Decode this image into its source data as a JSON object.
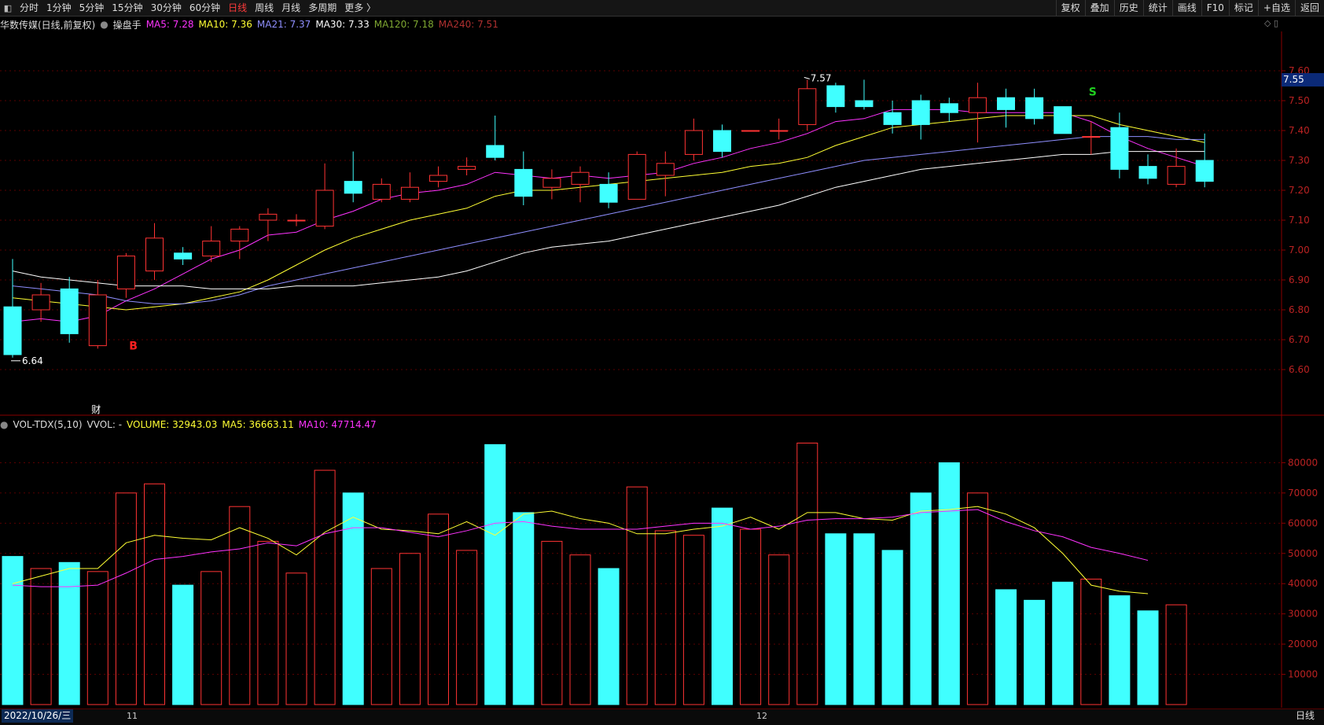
{
  "toolbar": {
    "tabs": [
      {
        "label": "分时",
        "active": false
      },
      {
        "label": "1分钟",
        "active": false
      },
      {
        "label": "5分钟",
        "active": false
      },
      {
        "label": "15分钟",
        "active": false
      },
      {
        "label": "30分钟",
        "active": false
      },
      {
        "label": "60分钟",
        "active": false
      },
      {
        "label": "日线",
        "active": true
      },
      {
        "label": "周线",
        "active": false
      },
      {
        "label": "月线",
        "active": false
      },
      {
        "label": "多周期",
        "active": false
      },
      {
        "label": "更多 〉",
        "active": false
      }
    ],
    "right_tools": [
      "复权",
      "叠加",
      "历史",
      "统计",
      "画线",
      "F10",
      "标记",
      "+自选",
      "返回"
    ]
  },
  "price_info": {
    "stock": "华数传媒(日线,前复权)",
    "indicator": "操盘手",
    "ma": [
      {
        "label": "MA5: 7.28",
        "color": "#ff33ff"
      },
      {
        "label": "MA10: 7.36",
        "color": "#ffff33"
      },
      {
        "label": "MA21: 7.37",
        "color": "#8f8fff"
      },
      {
        "label": "MA30: 7.33",
        "color": "#ffffff"
      },
      {
        "label": "MA120: 7.18",
        "color": "#7fa832"
      },
      {
        "label": "MA240: 7.51",
        "color": "#b03030"
      }
    ]
  },
  "vol_info": {
    "name": "VOL-TDX(5,10)",
    "vvol": "VVOL: -",
    "volume": "VOLUME: 32943.03",
    "ma5": "MA5: 36663.11",
    "ma10": "MA10: 47714.47"
  },
  "markers": {
    "high_label": "7.57",
    "low_label": "6.64",
    "buy": "B",
    "sell": "S",
    "finance": "财",
    "current_price": "7.55"
  },
  "colors": {
    "up": "#ff3333",
    "down": "#40ffff",
    "grid": "#5a0000",
    "axis": "#c0c0c0"
  },
  "x_axis": {
    "date": "2022/10/26/三",
    "month_11": "11",
    "month_12": "12",
    "period": "日线"
  },
  "chart_data": [
    {
      "type": "candlestick",
      "title": "华数传媒(日线,前复权)",
      "ylim": [
        6.6,
        7.6
      ],
      "y_ticks": [
        "7.60",
        "7.50",
        "7.40",
        "7.30",
        "7.20",
        "7.10",
        "7.00",
        "6.90",
        "6.80",
        "6.70",
        "6.60"
      ],
      "candles": [
        {
          "o": 6.81,
          "h": 6.97,
          "l": 6.64,
          "c": 6.65
        },
        {
          "o": 6.8,
          "h": 6.89,
          "l": 6.76,
          "c": 6.85
        },
        {
          "o": 6.87,
          "h": 6.91,
          "l": 6.69,
          "c": 6.72
        },
        {
          "o": 6.68,
          "h": 6.9,
          "l": 6.67,
          "c": 6.85
        },
        {
          "o": 6.87,
          "h": 6.99,
          "l": 6.84,
          "c": 6.98
        },
        {
          "o": 6.93,
          "h": 7.09,
          "l": 6.9,
          "c": 7.04
        },
        {
          "o": 6.99,
          "h": 7.01,
          "l": 6.95,
          "c": 6.97
        },
        {
          "o": 6.98,
          "h": 7.08,
          "l": 6.96,
          "c": 7.03
        },
        {
          "o": 7.03,
          "h": 7.08,
          "l": 6.97,
          "c": 7.07
        },
        {
          "o": 7.1,
          "h": 7.14,
          "l": 7.03,
          "c": 7.12
        },
        {
          "o": 7.1,
          "h": 7.12,
          "l": 7.08,
          "c": 7.1
        },
        {
          "o": 7.08,
          "h": 7.29,
          "l": 7.07,
          "c": 7.2
        },
        {
          "o": 7.23,
          "h": 7.33,
          "l": 7.16,
          "c": 7.19
        },
        {
          "o": 7.17,
          "h": 7.24,
          "l": 7.16,
          "c": 7.22
        },
        {
          "o": 7.17,
          "h": 7.26,
          "l": 7.16,
          "c": 7.21
        },
        {
          "o": 7.23,
          "h": 7.28,
          "l": 7.21,
          "c": 7.25
        },
        {
          "o": 7.27,
          "h": 7.31,
          "l": 7.25,
          "c": 7.28
        },
        {
          "o": 7.35,
          "h": 7.45,
          "l": 7.3,
          "c": 7.31
        },
        {
          "o": 7.27,
          "h": 7.33,
          "l": 7.15,
          "c": 7.18
        },
        {
          "o": 7.21,
          "h": 7.27,
          "l": 7.17,
          "c": 7.24
        },
        {
          "o": 7.22,
          "h": 7.28,
          "l": 7.16,
          "c": 7.26
        },
        {
          "o": 7.22,
          "h": 7.26,
          "l": 7.14,
          "c": 7.16
        },
        {
          "o": 7.17,
          "h": 7.33,
          "l": 7.17,
          "c": 7.32
        },
        {
          "o": 7.25,
          "h": 7.33,
          "l": 7.18,
          "c": 7.29
        },
        {
          "o": 7.32,
          "h": 7.44,
          "l": 7.3,
          "c": 7.4
        },
        {
          "o": 7.4,
          "h": 7.42,
          "l": 7.31,
          "c": 7.33
        },
        {
          "o": 7.4,
          "h": 7.4,
          "l": 7.4,
          "c": 7.4
        },
        {
          "o": 7.4,
          "h": 7.44,
          "l": 7.37,
          "c": 7.4
        },
        {
          "o": 7.42,
          "h": 7.57,
          "l": 7.4,
          "c": 7.54
        },
        {
          "o": 7.55,
          "h": 7.56,
          "l": 7.46,
          "c": 7.48
        },
        {
          "o": 7.5,
          "h": 7.57,
          "l": 7.47,
          "c": 7.48
        },
        {
          "o": 7.46,
          "h": 7.5,
          "l": 7.39,
          "c": 7.42
        },
        {
          "o": 7.5,
          "h": 7.52,
          "l": 7.37,
          "c": 7.42
        },
        {
          "o": 7.49,
          "h": 7.51,
          "l": 7.43,
          "c": 7.46
        },
        {
          "o": 7.46,
          "h": 7.56,
          "l": 7.36,
          "c": 7.51
        },
        {
          "o": 7.51,
          "h": 7.54,
          "l": 7.41,
          "c": 7.47
        },
        {
          "o": 7.51,
          "h": 7.54,
          "l": 7.42,
          "c": 7.44
        },
        {
          "o": 7.48,
          "h": 7.48,
          "l": 7.39,
          "c": 7.39
        },
        {
          "o": 7.38,
          "h": 7.43,
          "l": 7.32,
          "c": 7.38
        },
        {
          "o": 7.41,
          "h": 7.46,
          "l": 7.24,
          "c": 7.27
        },
        {
          "o": 7.28,
          "h": 7.32,
          "l": 7.22,
          "c": 7.24
        },
        {
          "o": 7.22,
          "h": 7.34,
          "l": 7.21,
          "c": 7.28
        },
        {
          "o": 7.3,
          "h": 7.39,
          "l": 7.21,
          "c": 7.23
        }
      ],
      "series": [
        {
          "name": "MA5",
          "color": "#ff33ff",
          "values": [
            6.76,
            6.77,
            6.76,
            6.78,
            6.83,
            6.87,
            6.92,
            6.97,
            7.0,
            7.05,
            7.06,
            7.1,
            7.13,
            7.17,
            7.19,
            7.2,
            7.22,
            7.26,
            7.25,
            7.24,
            7.25,
            7.24,
            7.25,
            7.26,
            7.29,
            7.31,
            7.34,
            7.36,
            7.39,
            7.43,
            7.44,
            7.47,
            7.47,
            7.47,
            7.46,
            7.46,
            7.46,
            7.46,
            7.43,
            7.38,
            7.34,
            7.31,
            7.28
          ]
        },
        {
          "name": "MA10",
          "color": "#ffff33",
          "values": [
            6.84,
            6.83,
            6.82,
            6.81,
            6.8,
            6.81,
            6.82,
            6.84,
            6.86,
            6.9,
            6.95,
            7.0,
            7.04,
            7.07,
            7.1,
            7.12,
            7.14,
            7.18,
            7.2,
            7.2,
            7.21,
            7.22,
            7.23,
            7.24,
            7.25,
            7.26,
            7.28,
            7.29,
            7.31,
            7.35,
            7.38,
            7.41,
            7.42,
            7.43,
            7.44,
            7.45,
            7.45,
            7.45,
            7.45,
            7.42,
            7.4,
            7.38,
            7.36
          ]
        },
        {
          "name": "MA21",
          "color": "#8f8fff",
          "values": [
            6.88,
            6.87,
            6.86,
            6.85,
            6.83,
            6.82,
            6.82,
            6.83,
            6.85,
            6.88,
            6.9,
            6.92,
            6.94,
            6.96,
            6.98,
            7.0,
            7.02,
            7.04,
            7.06,
            7.08,
            7.1,
            7.12,
            7.14,
            7.16,
            7.18,
            7.2,
            7.22,
            7.24,
            7.26,
            7.28,
            7.3,
            7.31,
            7.32,
            7.33,
            7.34,
            7.35,
            7.36,
            7.37,
            7.38,
            7.38,
            7.38,
            7.37,
            7.37
          ]
        },
        {
          "name": "MA30",
          "color": "#ffffff",
          "values": [
            6.93,
            6.91,
            6.9,
            6.89,
            6.88,
            6.88,
            6.88,
            6.87,
            6.87,
            6.87,
            6.88,
            6.88,
            6.88,
            6.89,
            6.9,
            6.91,
            6.93,
            6.96,
            6.99,
            7.01,
            7.02,
            7.03,
            7.05,
            7.07,
            7.09,
            7.11,
            7.13,
            7.15,
            7.18,
            7.21,
            7.23,
            7.25,
            7.27,
            7.28,
            7.29,
            7.3,
            7.31,
            7.32,
            7.32,
            7.33,
            7.33,
            7.33,
            7.33
          ]
        }
      ]
    },
    {
      "type": "bar",
      "title": "VOL-TDX(5,10)",
      "ylim": [
        0,
        90000
      ],
      "y_ticks": [
        "80000",
        "70000",
        "60000",
        "50000",
        "40000",
        "30000",
        "20000",
        "10000"
      ],
      "values": [
        49000,
        45000,
        47000,
        44000,
        70000,
        73000,
        39500,
        44000,
        65500,
        54000,
        43500,
        77500,
        70000,
        45000,
        50000,
        63000,
        51000,
        86000,
        63500,
        54000,
        49500,
        45000,
        72000,
        57500,
        56000,
        65000,
        58000,
        49500,
        86500,
        56500,
        56500,
        51000,
        70000,
        80000,
        70000,
        38000,
        34500,
        40500,
        41500,
        36000,
        31000,
        33000
      ],
      "series": [
        {
          "name": "MA5",
          "color": "#ffff33",
          "values": [
            40000,
            42500,
            45000,
            45000,
            53500,
            56000,
            55000,
            54500,
            58500,
            55000,
            49500,
            57000,
            62000,
            58000,
            57500,
            56500,
            60500,
            56000,
            63000,
            64000,
            61500,
            60000,
            56500,
            56500,
            58000,
            59000,
            62000,
            58000,
            63500,
            63500,
            61500,
            61000,
            64000,
            64500,
            65500,
            63000,
            58500,
            50000,
            39500,
            37500,
            36663
          ]
        },
        {
          "name": "MA10",
          "color": "#ff33ff",
          "values": [
            39500,
            39000,
            39000,
            39500,
            43500,
            48000,
            49000,
            50500,
            51500,
            53500,
            52500,
            56500,
            58500,
            58500,
            57000,
            55500,
            57500,
            60000,
            60500,
            59000,
            58000,
            58000,
            58000,
            59000,
            60000,
            60000,
            58000,
            59000,
            61000,
            61500,
            61500,
            62000,
            63500,
            64000,
            64500,
            60500,
            57500,
            55500,
            52000,
            50000,
            47714
          ]
        }
      ]
    }
  ]
}
